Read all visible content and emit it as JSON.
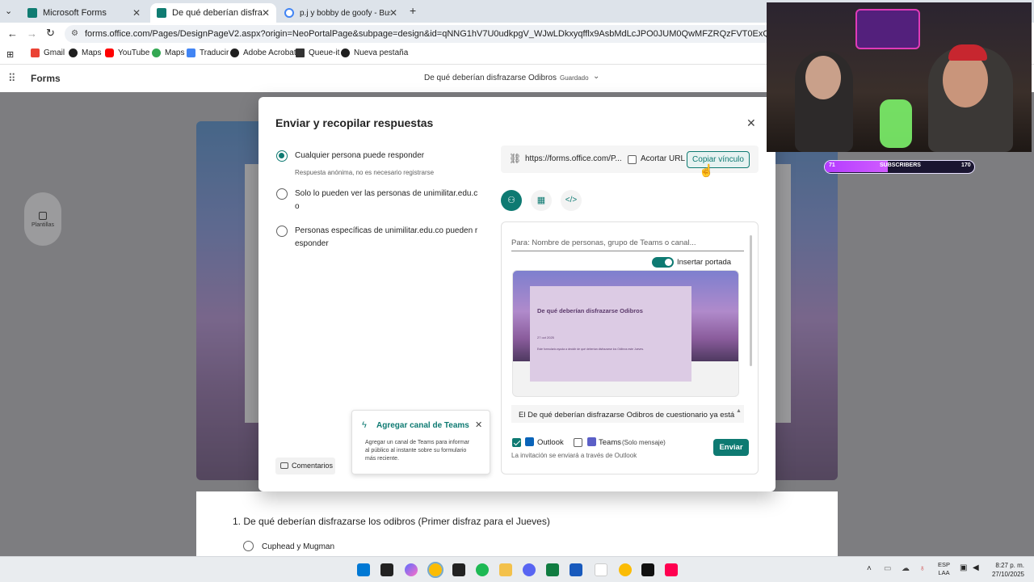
{
  "browser": {
    "tabs": [
      {
        "label": "Microsoft Forms",
        "color": "#107c72"
      },
      {
        "label": "De qué deberían disfrazarse Od",
        "color": "#107c72"
      },
      {
        "label": "p.j y bobby de goofy - Buscar c",
        "color": "#4285f4"
      }
    ],
    "url": "forms.office.com/Pages/DesignPageV2.aspx?origin=NeoPortalPage&subpage=design&id=qNNG1hV7U0udkpgV_WJwLDkxyqfflx9AsbMdLcJPO0JUM0QwMFZRQzFVT0ExQzNLQkhRTDZRRFZUWS4u",
    "bookmarks": [
      "Gmail",
      "Maps",
      "YouTube",
      "Maps",
      "Traducir",
      "Adobe Acrobat",
      "Queue-it",
      "Nueva pestaña"
    ]
  },
  "forms": {
    "app_name": "Forms",
    "doc_title": "De qué deberían disfrazarse Odibros",
    "status": "Guardado",
    "plantillas": "Plantillas",
    "comentarios": "Comentarios",
    "question": "1. De qué deberían disfrazarse los odibros (Primer disfraz para el Jueves)",
    "option1": "Cuphead y Mugman"
  },
  "modal": {
    "title": "Enviar y recopilar respuestas",
    "options": [
      {
        "label": "Cualquier persona puede responder",
        "sub": "Respuesta anónima, no es necesario registrarse",
        "selected": true
      },
      {
        "label_l1": "Solo lo pueden ver las personas de unimilitar.edu.c",
        "label_l2": "o",
        "selected": false
      },
      {
        "label_l1": "Personas específicas de unimilitar.edu.co pueden r",
        "label_l2": "esponder",
        "selected": false
      }
    ],
    "link": "https://forms.office.com/P...",
    "shorten": "Acortar URL",
    "copy": "Copiar vínculo",
    "to_placeholder": "Para: Nombre de personas, grupo de Teams o canal...",
    "insert_cover": "Insertar portada",
    "preview_title": "De qué deberían disfrazarse Odibros",
    "preview_date": "27 oct 2025",
    "preview_text": "Este formulario ayuda a decidir de qué deberían disfrazarse los Odibros este Jueves.",
    "message": "El De qué deberían disfrazarse Odibros  de cuestionario ya está",
    "outlook": "Outlook",
    "teams": "Teams",
    "teams_note": "(Solo mensaje)",
    "footer": "La invitación se enviará a través de Outlook",
    "send": "Enviar"
  },
  "teams_callout": {
    "title": "Agregar canal de Teams",
    "body_l1": "Agregar un canal de Teams para informar",
    "body_l2": "al público al instante sobre su formulario",
    "body_l3": "más reciente."
  },
  "subscribers": {
    "left": "71",
    "label": "SUBSCRIBERS",
    "right": "170",
    "progress": 0.42
  },
  "taskbar": {
    "lang1": "ESP",
    "lang2": "LAA",
    "time": "8:27 p. m.",
    "date": "27/10/2025"
  },
  "colors": {
    "accent": "#0e7a72"
  }
}
